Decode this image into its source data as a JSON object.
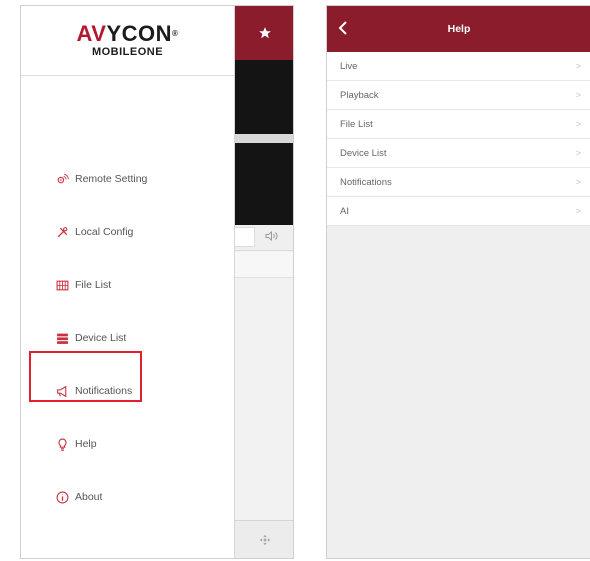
{
  "left_screen": {
    "logo": {
      "brand_prefix": "AV",
      "brand_main": "YCON",
      "trademark": "®",
      "subtitle": "MOBILEONE"
    },
    "menu": [
      {
        "label": "Remote Setting",
        "icon": "remote-setting-icon"
      },
      {
        "label": "Local Config",
        "icon": "tools-icon"
      },
      {
        "label": "File List",
        "icon": "file-list-icon"
      },
      {
        "label": "Device List",
        "icon": "device-list-icon"
      },
      {
        "label": "Notifications",
        "icon": "megaphone-icon"
      },
      {
        "label": "Help",
        "icon": "lightbulb-icon"
      },
      {
        "label": "About",
        "icon": "info-icon"
      }
    ],
    "highlighted_item": "Help"
  },
  "right_screen": {
    "header": {
      "title": "Help",
      "back_icon": "chevron-left-icon"
    },
    "items": [
      {
        "label": "Live"
      },
      {
        "label": "Playback"
      },
      {
        "label": "File List"
      },
      {
        "label": "Device List"
      },
      {
        "label": "Notifications"
      },
      {
        "label": "AI"
      }
    ],
    "chevron": ">"
  },
  "colors": {
    "brand_red": "#8b1c2c",
    "highlight_red": "#e0202f",
    "logo_accent": "#b3192d"
  }
}
